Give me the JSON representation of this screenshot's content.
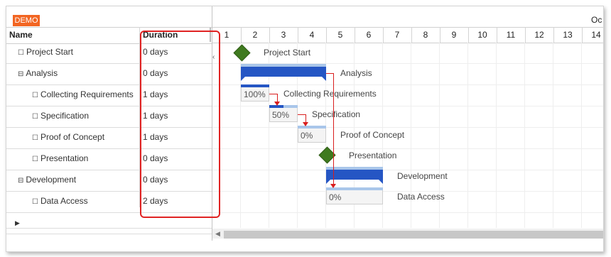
{
  "badge": "DEMO",
  "grid": {
    "columns": {
      "name": "Name",
      "duration": "Duration"
    },
    "rows": [
      {
        "name": "Project Start",
        "duration": "0 days",
        "toggle": "☐",
        "level": 1
      },
      {
        "name": "Analysis",
        "duration": "0 days",
        "toggle": "⊟",
        "level": 1
      },
      {
        "name": "Collecting Requirements",
        "duration": "1 days",
        "toggle": "☐",
        "level": 2
      },
      {
        "name": "Specification",
        "duration": "1 days",
        "toggle": "☐",
        "level": 2
      },
      {
        "name": "Proof of Concept",
        "duration": "1 days",
        "toggle": "☐",
        "level": 2
      },
      {
        "name": "Presentation",
        "duration": "0 days",
        "toggle": "☐",
        "level": 2
      },
      {
        "name": "Development",
        "duration": "0 days",
        "toggle": "⊟",
        "level": 1
      },
      {
        "name": "Data Access",
        "duration": "2 days",
        "toggle": "☐",
        "level": 2
      }
    ],
    "new_row_caret": "▶"
  },
  "chart": {
    "month": "Oc",
    "days": [
      "1",
      "2",
      "3",
      "4",
      "5",
      "6",
      "7",
      "8",
      "9",
      "10",
      "11",
      "12",
      "13",
      "14"
    ],
    "bars": {
      "project_start": {
        "label": "Project Start"
      },
      "analysis": {
        "label": "Analysis"
      },
      "collecting": {
        "label": "Collecting Requirements",
        "progress_text": "100%",
        "progress": 1.0
      },
      "specification": {
        "label": "Specification",
        "progress_text": "50%",
        "progress": 0.5
      },
      "proof": {
        "label": "Proof of Concept",
        "progress_text": "0%",
        "progress": 0.0
      },
      "presentation": {
        "label": "Presentation"
      },
      "development": {
        "label": "Development"
      },
      "data_access": {
        "label": "Data Access",
        "progress_text": "0%",
        "progress": 0.0
      }
    }
  },
  "colors": {
    "badge": "#f26522",
    "milestone": "#3f7a1f",
    "summary": "#2556c4",
    "link": "#d91e1e",
    "highlight": "#e02323"
  },
  "icons": {
    "scroll_left": "caret-left-icon",
    "new_row": "caret-right-icon"
  }
}
